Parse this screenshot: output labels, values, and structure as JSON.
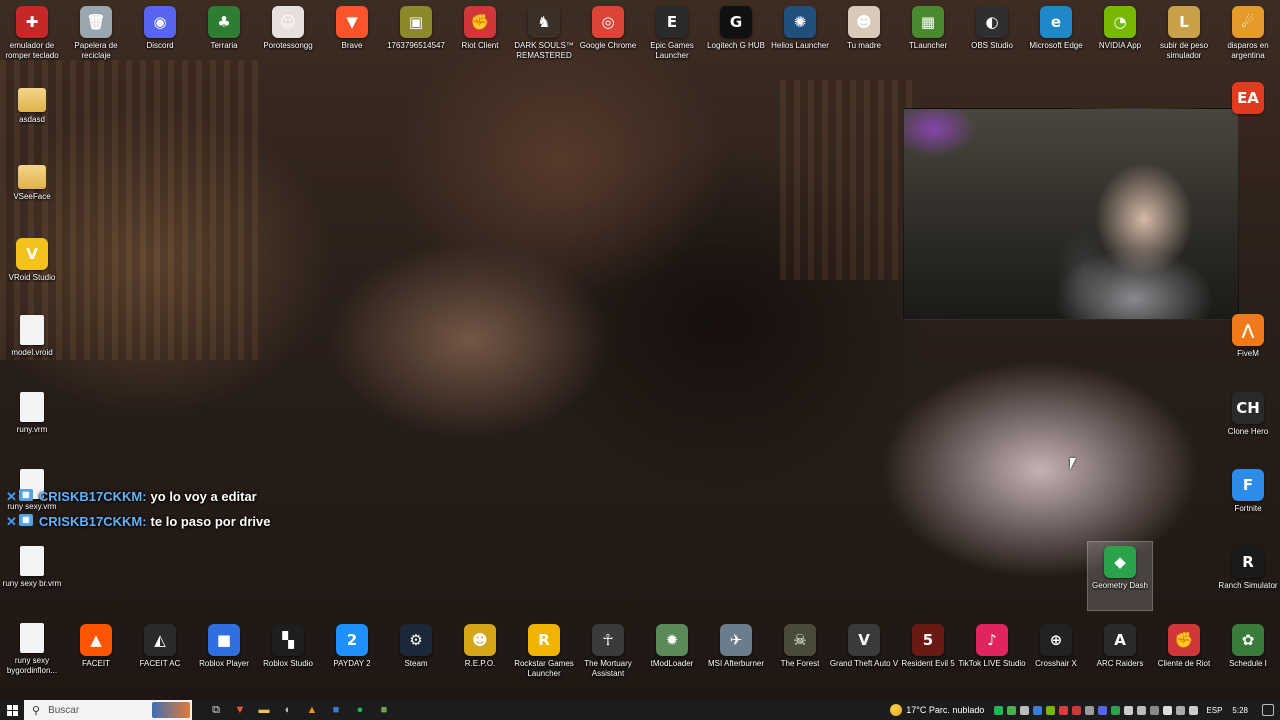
{
  "desktop": {
    "top_row": [
      {
        "label": "emulador de romper teclado",
        "icon": "emulator-icon",
        "color": "#c62828",
        "glyph": "✚"
      },
      {
        "label": "Papelera de reciclaje",
        "icon": "recycle-bin-icon",
        "color": "#9aa7b0",
        "glyph": "🗑"
      },
      {
        "label": "Discord",
        "icon": "discord-icon",
        "color": "#5865f2",
        "glyph": "◉"
      },
      {
        "label": "Terraria",
        "icon": "terraria-icon",
        "color": "#2e7d32",
        "glyph": "♣"
      },
      {
        "label": "Porotessongg",
        "icon": "porotessongg-icon",
        "color": "#e8e0dc",
        "glyph": "☺"
      },
      {
        "label": "Brave",
        "icon": "brave-icon",
        "color": "#fb542b",
        "glyph": "▼"
      },
      {
        "label": "1763796514547",
        "icon": "image-file-icon",
        "color": "#8a8a2a",
        "glyph": "▣"
      },
      {
        "label": "Riot Client",
        "icon": "riot-client-icon",
        "color": "#d13639",
        "glyph": "✊"
      },
      {
        "label": "DARK SOULS™ REMASTERED",
        "icon": "dark-souls-icon",
        "color": "#3a3028",
        "glyph": "♞"
      },
      {
        "label": "Google Chrome",
        "icon": "chrome-icon",
        "color": "#db4437",
        "glyph": "◎"
      },
      {
        "label": "Epic Games Launcher",
        "icon": "epic-games-icon",
        "color": "#2a2a2a",
        "glyph": "E"
      },
      {
        "label": "Logitech G HUB",
        "icon": "logitech-ghub-icon",
        "color": "#111111",
        "glyph": "G"
      },
      {
        "label": "Helios Launcher",
        "icon": "helios-launcher-icon",
        "color": "#1f4f7a",
        "glyph": "✺"
      },
      {
        "label": "Tu madre",
        "icon": "tu-madre-icon",
        "color": "#d8c9b8",
        "glyph": "☻"
      },
      {
        "label": "TLauncher",
        "icon": "tlauncher-icon",
        "color": "#4a8a2e",
        "glyph": "▦"
      },
      {
        "label": "OBS Studio",
        "icon": "obs-studio-icon",
        "color": "#302e31",
        "glyph": "◐"
      },
      {
        "label": "Microsoft Edge",
        "icon": "edge-icon",
        "color": "#1e88c9",
        "glyph": "e"
      },
      {
        "label": "NVIDIA App",
        "icon": "nvidia-icon",
        "color": "#76b900",
        "glyph": "◔"
      },
      {
        "label": "subir de peso simulador",
        "icon": "league-icon",
        "color": "#c8a04a",
        "glyph": "L"
      },
      {
        "label": "disparos en argentina",
        "icon": "counter-strike-icon",
        "color": "#e59b2a",
        "glyph": "☄"
      }
    ],
    "left_column": [
      {
        "label": "asdasd",
        "icon": "folder-icon",
        "type": "folder"
      },
      {
        "label": "VSeeFace",
        "icon": "folder-icon",
        "type": "folder"
      },
      {
        "label": "VRoid Studio",
        "icon": "vroid-studio-icon",
        "type": "app",
        "color": "#f3c21c",
        "glyph": "V"
      },
      {
        "label": "model.vroid",
        "icon": "document-icon",
        "type": "doc"
      },
      {
        "label": "runy.vrm",
        "icon": "document-icon",
        "type": "doc"
      },
      {
        "label": "runy sexy.vrm",
        "icon": "document-icon",
        "type": "doc"
      },
      {
        "label": "runy sexy br.vrm",
        "icon": "document-icon",
        "type": "doc"
      },
      {
        "label": "runy sexy bygordinflon...",
        "icon": "document-icon",
        "type": "doc"
      }
    ],
    "right_column": [
      {
        "label": "",
        "icon": "ea-icon",
        "color": "#e03a1f",
        "glyph": "EA"
      },
      {
        "label": "FiveM",
        "icon": "fivem-icon",
        "color": "#f07a1a",
        "glyph": "⋀"
      },
      {
        "label": "Clone Hero",
        "icon": "clone-hero-icon",
        "color": "#2a2a2a",
        "glyph": "CH"
      },
      {
        "label": "Fortnite",
        "icon": "fortnite-icon",
        "color": "#2d8ce8",
        "glyph": "F"
      },
      {
        "label": "Ranch Simulator",
        "icon": "ranch-simulator-icon",
        "color": "#1a1a1a",
        "glyph": "R"
      }
    ],
    "geometry_dash": {
      "label": "Geometry Dash",
      "icon": "geometry-dash-icon",
      "color": "#2aa34a",
      "glyph": "◆"
    },
    "bottom_row": [
      {
        "label": "FACEIT",
        "icon": "faceit-icon",
        "color": "#ff5500",
        "glyph": "▲"
      },
      {
        "label": "FACEIT AC",
        "icon": "faceit-ac-icon",
        "color": "#2b2b2b",
        "glyph": "◭"
      },
      {
        "label": "Roblox Player",
        "icon": "roblox-player-icon",
        "color": "#2f6fe0",
        "glyph": "■"
      },
      {
        "label": "Roblox Studio",
        "icon": "roblox-studio-icon",
        "color": "#1e1e1e",
        "glyph": "▚"
      },
      {
        "label": "PAYDAY 2",
        "icon": "payday-2-icon",
        "color": "#1e90ff",
        "glyph": "2"
      },
      {
        "label": "Steam",
        "icon": "steam-icon",
        "color": "#1b2838",
        "glyph": "⚙"
      },
      {
        "label": "R.E.P.O.",
        "icon": "repo-icon",
        "color": "#d4a517",
        "glyph": "☻"
      },
      {
        "label": "Rockstar Games Launcher",
        "icon": "rockstar-icon",
        "color": "#f0b400",
        "glyph": "R"
      },
      {
        "label": "The Mortuary Assistant",
        "icon": "mortuary-assistant-icon",
        "color": "#3b3b3b",
        "glyph": "☥"
      },
      {
        "label": "tModLoader",
        "icon": "tmodloader-icon",
        "color": "#5b8a5a",
        "glyph": "✹"
      },
      {
        "label": "MSI Afterburner",
        "icon": "msi-afterburner-icon",
        "color": "#6b7d8a",
        "glyph": "✈"
      },
      {
        "label": "The Forest",
        "icon": "the-forest-icon",
        "color": "#4a4a38",
        "glyph": "☠"
      },
      {
        "label": "Grand Theft Auto V",
        "icon": "gta-v-icon",
        "color": "#3a3a3a",
        "glyph": "V"
      },
      {
        "label": "Resident Evil 5",
        "icon": "resident-evil-5-icon",
        "color": "#6a1a12",
        "glyph": "5"
      },
      {
        "label": "TikTok LIVE Studio",
        "icon": "tiktok-live-icon",
        "color": "#e0245e",
        "glyph": "♪"
      },
      {
        "label": "Crosshair X",
        "icon": "crosshair-x-icon",
        "color": "#222222",
        "glyph": "⊕"
      },
      {
        "label": "ARC Raiders",
        "icon": "arc-raiders-icon",
        "color": "#2a2a2a",
        "glyph": "A"
      },
      {
        "label": "Cliente de Riot",
        "icon": "riot-client-icon",
        "color": "#d13639",
        "glyph": "✊"
      },
      {
        "label": "Schedule I",
        "icon": "schedule-i-icon",
        "color": "#3a7a3a",
        "glyph": "✿"
      }
    ]
  },
  "chat": [
    {
      "user": "CRISKB17CKKM:",
      "message": "yo lo voy a editar"
    },
    {
      "user": "CRISKB17CKKM:",
      "message": "te lo paso por drive"
    }
  ],
  "taskbar": {
    "search_placeholder": "Buscar",
    "pinned": [
      {
        "icon": "task-view-icon",
        "glyph": "⧉",
        "color": "#dddddd"
      },
      {
        "icon": "brave-icon",
        "glyph": "▼",
        "color": "#fb542b"
      },
      {
        "icon": "file-explorer-icon",
        "glyph": "▬",
        "color": "#f0c24a"
      },
      {
        "icon": "obs-studio-icon",
        "glyph": "◐",
        "color": "#bbbbbb"
      },
      {
        "icon": "vlc-icon",
        "glyph": "▲",
        "color": "#f08a1a"
      },
      {
        "icon": "store-icon",
        "glyph": "■",
        "color": "#3a7bd5"
      },
      {
        "icon": "spotify-icon",
        "glyph": "●",
        "color": "#1db954"
      },
      {
        "icon": "minecraft-icon",
        "glyph": "■",
        "color": "#6aa84f"
      }
    ],
    "weather": {
      "temp": "17°C",
      "condition": "Parc. nublado"
    },
    "tray_colors": [
      "#1db954",
      "#4caf50",
      "#bbbbbb",
      "#3a7bd5",
      "#76b900",
      "#e03a3a",
      "#d13639",
      "#9a9a9a",
      "#5865f2",
      "#2aa34a",
      "#cccccc",
      "#bbbbbb",
      "#888888",
      "#dddddd",
      "#aaaaaa",
      "#cccccc"
    ],
    "language": "ESP",
    "time": "5:28"
  }
}
